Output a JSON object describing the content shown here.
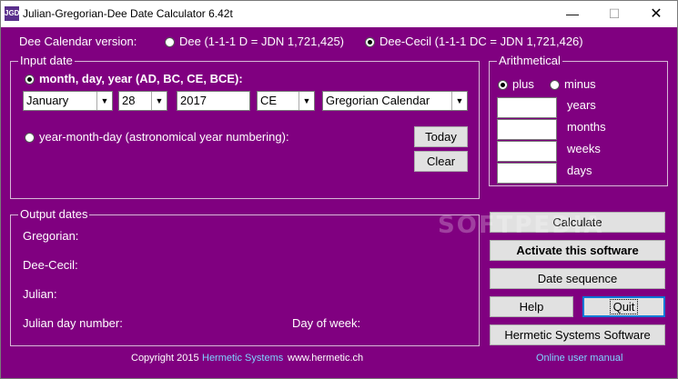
{
  "window": {
    "icon_text": "JGD",
    "title": "Julian-Gregorian-Dee Date Calculator 6.42t",
    "min_glyph": "—",
    "max_glyph": "☐",
    "close_glyph": "✕"
  },
  "version": {
    "label": "Dee Calendar version:",
    "option_dee": "Dee (1-1-1 D = JDN 1,721,425)",
    "option_dee_cecil": "Dee-Cecil (1-1-1 DC = JDN 1,721,426)",
    "selected": "dee_cecil"
  },
  "input": {
    "group_label": "Input date",
    "mode1_label": "month, day, year (AD, BC, CE, BCE):",
    "mode2_label": "year-month-day (astronomical year numbering):",
    "selected_mode": "mdy",
    "month": "January",
    "day": "28",
    "year": "2017",
    "era": "CE",
    "calendar": "Gregorian Calendar",
    "today_button": "Today",
    "clear_button": "Clear"
  },
  "arithmetical": {
    "group_label": "Arithmetical",
    "plus_label": "plus",
    "minus_label": "minus",
    "selected": "plus",
    "years_label": "years",
    "months_label": "months",
    "weeks_label": "weeks",
    "days_label": "days",
    "years_value": "",
    "months_value": "",
    "weeks_value": "",
    "days_value": ""
  },
  "output": {
    "group_label": "Output dates",
    "gregorian_label": "Gregorian:",
    "dee_cecil_label": "Dee-Cecil:",
    "julian_label": "Julian:",
    "jdn_label": "Julian day number:",
    "dow_label": "Day of week:"
  },
  "buttons": {
    "calculate": "Calculate",
    "activate": "Activate this software",
    "date_sequence": "Date sequence",
    "help": "Help",
    "quit": "Quit",
    "hermetic": "Hermetic Systems Software"
  },
  "footer": {
    "copyright": "Copyright 2015",
    "company": "Hermetic Systems",
    "website": "www.hermetic.ch",
    "manual": "Online user manual"
  },
  "watermark": "SOFTPEDIA",
  "colors": {
    "background": "#800080",
    "link": "#7fd4ff"
  }
}
